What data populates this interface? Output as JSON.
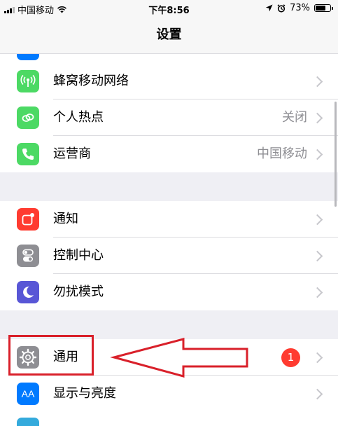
{
  "status": {
    "carrier": "中国移动",
    "time": "下午8:56",
    "battery": "73%",
    "battery_level": 0.73
  },
  "header": {
    "title": "设置"
  },
  "groups": [
    {
      "items": [
        {
          "label": "蜂窝移动网络",
          "icon": "cellular-antenna-icon",
          "color": "#4cd964"
        },
        {
          "label": "个人热点",
          "value": "关闭",
          "icon": "hotspot-link-icon",
          "color": "#4cd964"
        },
        {
          "label": "运营商",
          "value": "中国移动",
          "icon": "phone-icon",
          "color": "#4cd964"
        }
      ]
    },
    {
      "items": [
        {
          "label": "通知",
          "icon": "notifications-icon",
          "color": "#ff3b30"
        },
        {
          "label": "控制中心",
          "icon": "toggle-switches-icon",
          "color": "#8e8e93"
        },
        {
          "label": "勿扰模式",
          "icon": "moon-icon",
          "color": "#5856d6"
        }
      ]
    },
    {
      "items": [
        {
          "label": "通用",
          "badge": "1",
          "icon": "gear-icon",
          "color": "#8e8e93"
        },
        {
          "label": "显示与亮度",
          "icon": "text-size-icon",
          "icon_text": "AA",
          "color": "#007aff"
        }
      ]
    }
  ],
  "colors": {
    "annotation": "#d9202a",
    "background": "#efeff4"
  }
}
